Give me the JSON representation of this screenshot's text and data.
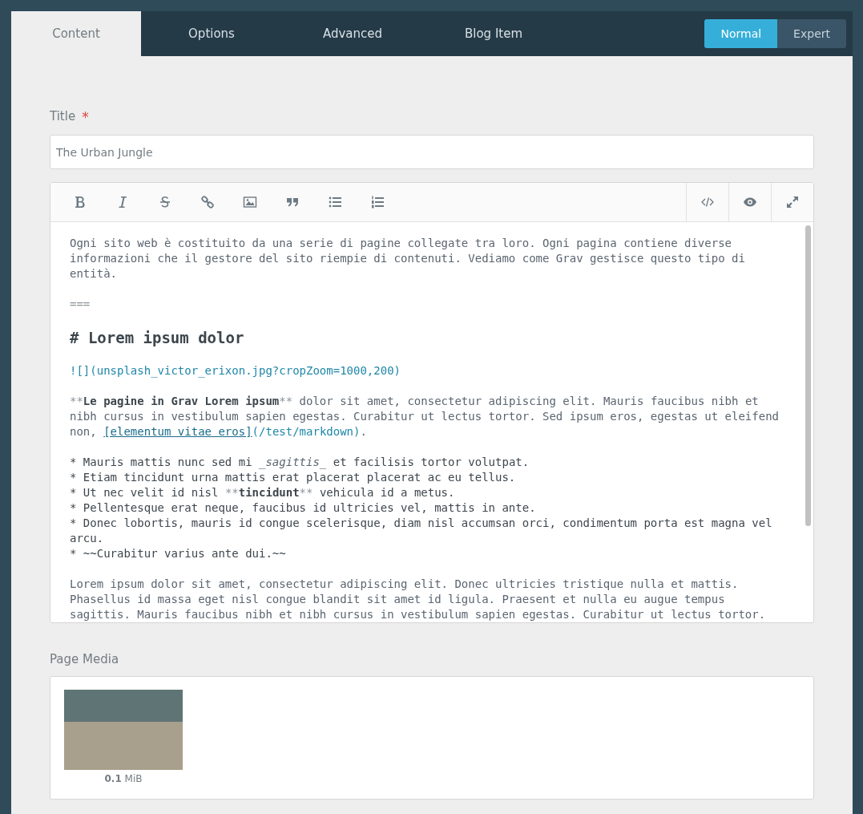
{
  "tabs": [
    {
      "label": "Content",
      "selected": true
    },
    {
      "label": "Options",
      "selected": false
    },
    {
      "label": "Advanced",
      "selected": false
    },
    {
      "label": "Blog Item",
      "selected": false
    }
  ],
  "mode_toggle": [
    {
      "label": "Normal",
      "selected": true
    },
    {
      "label": "Expert",
      "selected": false
    }
  ],
  "title_field": {
    "label": "Title",
    "required_mark": "*",
    "value": "The Urban Jungle"
  },
  "editor": {
    "toolbar": [
      {
        "kind": "bold"
      },
      {
        "kind": "italic"
      },
      {
        "kind": "strike"
      },
      {
        "kind": "link"
      },
      {
        "kind": "image"
      },
      {
        "kind": "quote"
      },
      {
        "kind": "bullets"
      },
      {
        "kind": "numbered"
      }
    ],
    "toolbar_right": [
      {
        "kind": "code"
      },
      {
        "kind": "preview"
      },
      {
        "kind": "fullscreen"
      }
    ],
    "blocks": [
      {
        "kind": "text",
        "segments": [
          {
            "kind": "plain",
            "text": "Ogni sito web è costituito da una serie di pagine collegate tra loro. Ogni pagina contiene diverse informazioni che il gestore del sito riempie di contenuti. Vediamo come Grav gestisce questo tipo di entità."
          }
        ]
      },
      {
        "kind": "text",
        "segments": [
          {
            "kind": "marker",
            "text": "==="
          }
        ]
      },
      {
        "kind": "heading",
        "text": "# Lorem ipsum dolor"
      },
      {
        "kind": "text",
        "segments": [
          {
            "kind": "url",
            "text": "![](unsplash_victor_erixon.jpg?cropZoom=1000,200)"
          }
        ]
      },
      {
        "kind": "text",
        "segments": [
          {
            "kind": "marker",
            "text": "**"
          },
          {
            "kind": "bold",
            "text": "Le pagine in Grav Lorem ipsum"
          },
          {
            "kind": "marker",
            "text": "**"
          },
          {
            "kind": "plain",
            "text": " dolor sit amet, consectetur adipiscing elit. Mauris faucibus nibh et nibh cursus in vestibulum sapien egestas. Curabitur ut lectus tortor. Sed ipsum eros, egestas ut eleifend non, "
          },
          {
            "kind": "link",
            "text": "[elementum vitae eros]"
          },
          {
            "kind": "url",
            "text": "(/test/markdown)"
          },
          {
            "kind": "plain",
            "text": "."
          }
        ]
      },
      {
        "kind": "list",
        "lines": [
          [
            {
              "kind": "list",
              "text": "* Mauris mattis nunc sed mi "
            },
            {
              "kind": "italic",
              "text": "_sagittis_"
            },
            {
              "kind": "list",
              "text": " et facilisis tortor volutpat."
            }
          ],
          [
            {
              "kind": "list",
              "text": "* Etiam tincidunt urna mattis erat placerat placerat ac eu tellus."
            }
          ],
          [
            {
              "kind": "list",
              "text": "* Ut nec velit id nisl "
            },
            {
              "kind": "marker",
              "text": "**"
            },
            {
              "kind": "bold",
              "text": "tincidunt"
            },
            {
              "kind": "marker",
              "text": "**"
            },
            {
              "kind": "list",
              "text": " vehicula id a metus."
            }
          ],
          [
            {
              "kind": "list",
              "text": "* Pellentesque erat neque, faucibus id ultricies vel, mattis in ante."
            }
          ],
          [
            {
              "kind": "list",
              "text": "* Donec lobortis, mauris id congue scelerisque, diam nisl accumsan orci, condimentum porta est magna vel arcu."
            }
          ],
          [
            {
              "kind": "list",
              "text": "* ~~Curabitur varius ante dui.~~"
            }
          ]
        ]
      },
      {
        "kind": "text",
        "segments": [
          {
            "kind": "plain",
            "text": "Lorem ipsum dolor sit amet, consectetur adipiscing elit. Donec ultricies tristique nulla et mattis. Phasellus id massa eget nisl congue blandit sit amet id ligula. Praesent et nulla eu augue tempus sagittis. Mauris faucibus nibh et nibh cursus in vestibulum sapien egestas. Curabitur ut lectus tortor."
          }
        ]
      }
    ]
  },
  "page_media": {
    "label": "Page Media",
    "items": [
      {
        "size_value": "0.1",
        "size_unit": "MiB"
      }
    ]
  }
}
